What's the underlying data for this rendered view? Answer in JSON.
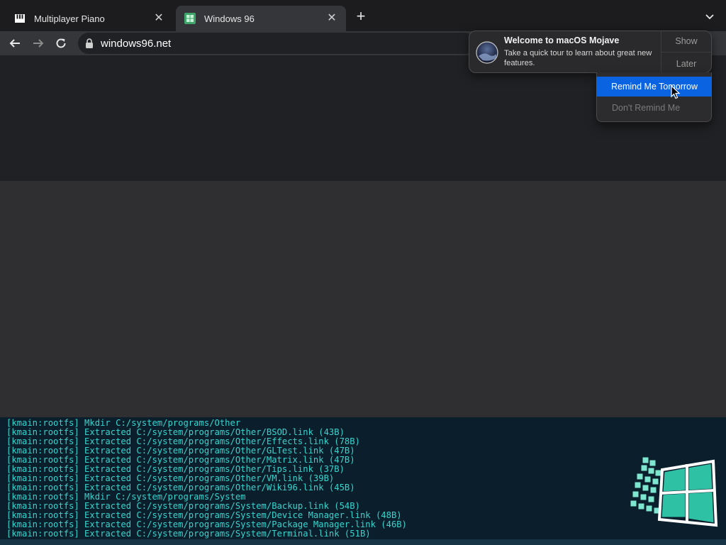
{
  "browser": {
    "tabs": [
      {
        "title": "Multiplayer Piano",
        "favicon": "piano-icon",
        "active": false
      },
      {
        "title": "Windows 96",
        "favicon": "windows96-icon",
        "active": true
      }
    ],
    "address": "windows96.net"
  },
  "notification": {
    "title": "Welcome to macOS Mojave",
    "body": "Take a quick tour to learn about great new features.",
    "show_label": "Show",
    "later_label": "Later",
    "menu": {
      "remind_tomorrow": "Remind Me Tomorrow",
      "dont_remind": "Don't Remind Me"
    }
  },
  "terminal": {
    "lines": [
      "[kmain:rootfs] Mkdir C:/system/programs/Other",
      "[kmain:rootfs] Extracted C:/system/programs/Other/BSOD.link (43B)",
      "[kmain:rootfs] Extracted C:/system/programs/Other/Effects.link (78B)",
      "[kmain:rootfs] Extracted C:/system/programs/Other/GLTest.link (47B)",
      "[kmain:rootfs] Extracted C:/system/programs/Other/Matrix.link (47B)",
      "[kmain:rootfs] Extracted C:/system/programs/Other/Tips.link (37B)",
      "[kmain:rootfs] Extracted C:/system/programs/Other/VM.link (39B)",
      "[kmain:rootfs] Extracted C:/system/programs/Other/Wiki96.link (45B)",
      "[kmain:rootfs] Mkdir C:/system/programs/System",
      "[kmain:rootfs] Extracted C:/system/programs/System/Backup.link (54B)",
      "[kmain:rootfs] Extracted C:/system/programs/System/Device Manager.link (48B)",
      "[kmain:rootfs] Extracted C:/system/programs/System/Package Manager.link (46B)",
      "[kmain:rootfs] Extracted C:/system/programs/System/Terminal.link (51B)"
    ],
    "text_color": "#37d5cf"
  },
  "colors": {
    "highlight": "#0a63e1",
    "terminal_bg": "#0a1f2b"
  }
}
